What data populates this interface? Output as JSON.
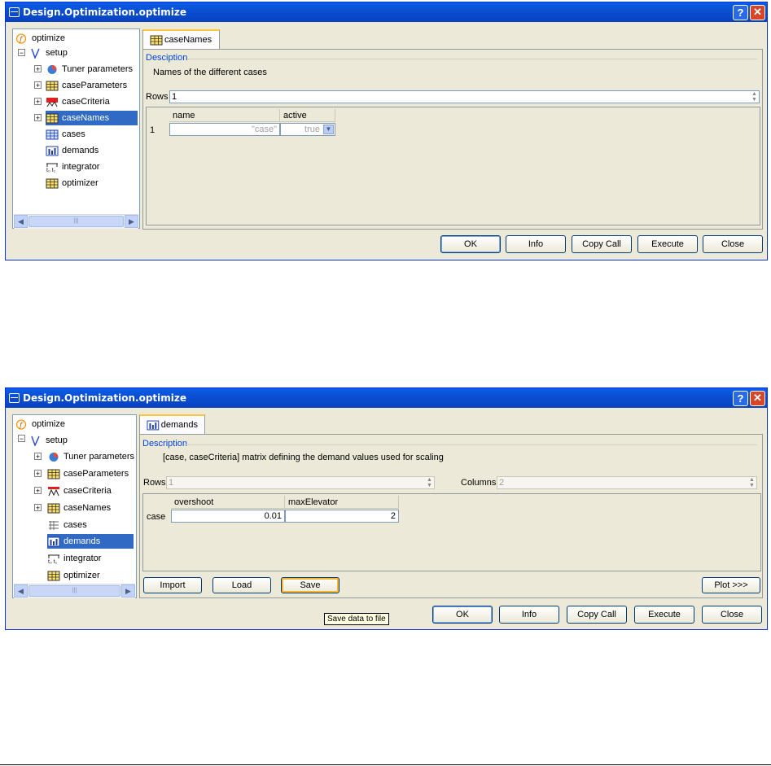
{
  "dialog1": {
    "title": "Design.Optimization.optimize",
    "help_label": "?",
    "close_label": "✕",
    "tree": [
      {
        "label": "optimize",
        "icon": "function-icon"
      },
      {
        "label": "setup",
        "icon": "check-v-icon"
      },
      {
        "label": "Tuner parameters",
        "icon": "pie-icon"
      },
      {
        "label": "caseParameters",
        "icon": "table-icon"
      },
      {
        "label": "caseCriteria",
        "icon": "criteria-icon"
      },
      {
        "label": "caseNames",
        "icon": "table-icon"
      },
      {
        "label": "cases",
        "icon": "grid-blue-icon"
      },
      {
        "label": "demands",
        "icon": "bar-chart-icon"
      },
      {
        "label": "integrator",
        "icon": "integrator-icon"
      },
      {
        "label": "optimizer",
        "icon": "table-icon"
      }
    ],
    "tab_label": "caseNames",
    "description_heading": "Desciption",
    "description": "Names of the different cases",
    "rows_label": "Rows",
    "rows_value": "1",
    "columns": [
      "name",
      "active"
    ],
    "row_header": "1",
    "cells": [
      "\"case\"",
      "true"
    ],
    "buttons": {
      "ok": "OK",
      "info": "Info",
      "copy_call": "Copy Call",
      "execute": "Execute",
      "close": "Close"
    }
  },
  "dialog2": {
    "title": "Design.Optimization.optimize",
    "help_label": "?",
    "close_label": "✕",
    "tree": [
      {
        "label": "optimize",
        "icon": "function-icon"
      },
      {
        "label": "setup",
        "icon": "check-v-icon"
      },
      {
        "label": "Tuner parameters",
        "icon": "pie-icon"
      },
      {
        "label": "caseParameters",
        "icon": "table-icon"
      },
      {
        "label": "caseCriteria",
        "icon": "criteria-icon"
      },
      {
        "label": "caseNames",
        "icon": "table-icon"
      },
      {
        "label": "cases",
        "icon": "list-icon"
      },
      {
        "label": "demands",
        "icon": "bar-chart-icon"
      },
      {
        "label": "integrator",
        "icon": "integrator-icon"
      },
      {
        "label": "optimizer",
        "icon": "table-icon"
      }
    ],
    "tab_label": "demands",
    "description_heading": "Description",
    "description": "[case, caseCriteria] matrix defining the demand values used for scaling",
    "rows_label": "Rows",
    "rows_value": "1",
    "columns_label": "Columns",
    "columns_value": "2",
    "columns": [
      "overshoot",
      "maxElevator"
    ],
    "row_header": "case",
    "cells": [
      "0.01",
      "2"
    ],
    "panel_buttons": {
      "import": "Import",
      "load": "Load",
      "save": "Save",
      "plot": "Plot >>>"
    },
    "tooltip": "Save data to file",
    "buttons": {
      "ok": "OK",
      "info": "Info",
      "copy_call": "Copy Call",
      "execute": "Execute",
      "close": "Close"
    }
  },
  "colors": {
    "title_bar": "#0a4fd3",
    "selection": "#316ac5",
    "tab_accent": "#ffc83c",
    "group_heading": "#0046d5"
  }
}
